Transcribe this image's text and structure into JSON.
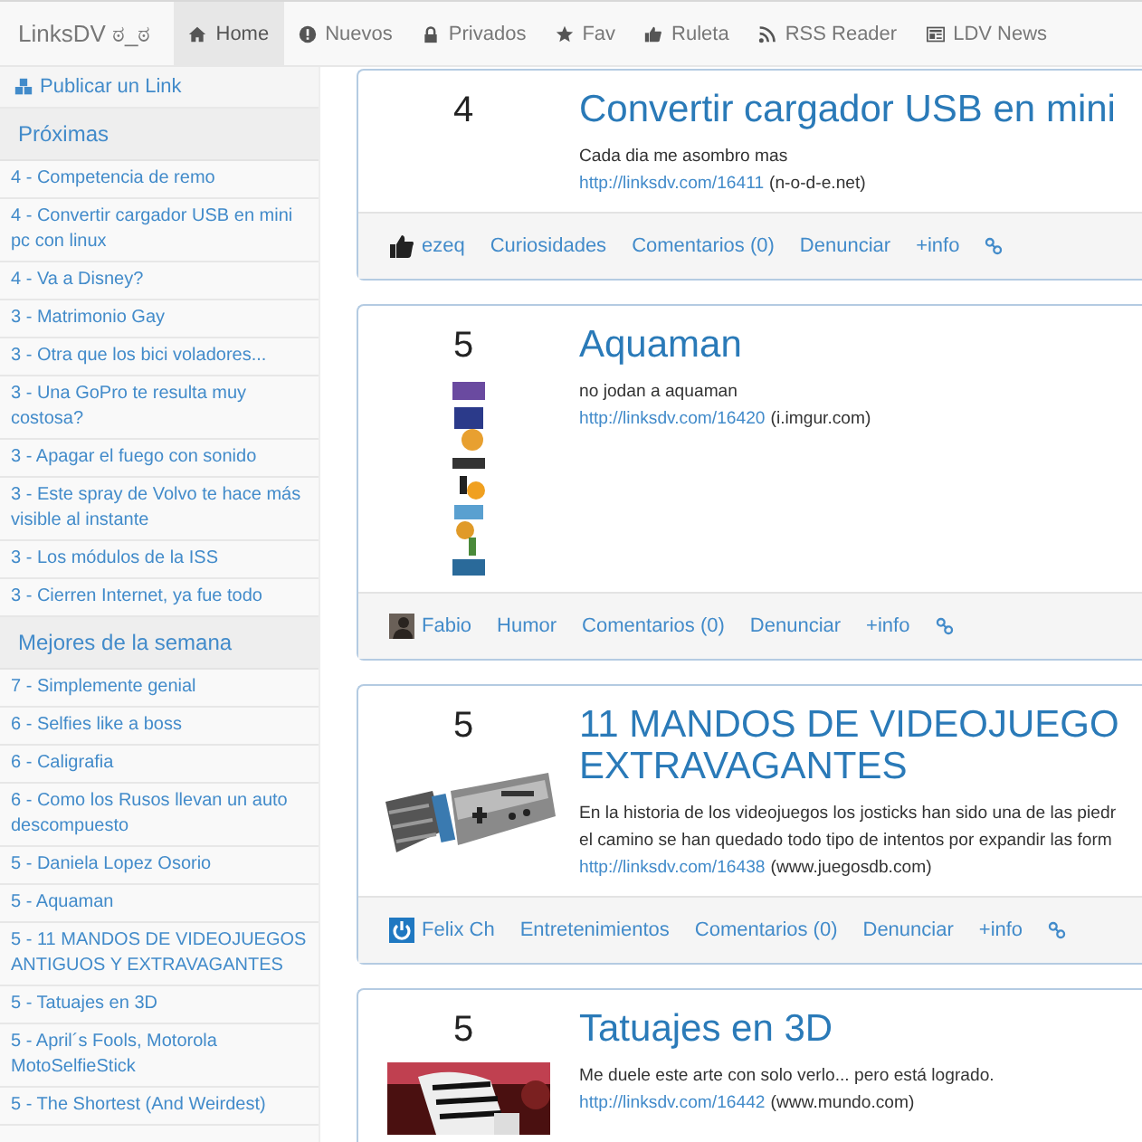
{
  "nav": {
    "brand": "LinksDV ಠ_ಠ",
    "items": [
      {
        "label": "Home",
        "selected": true
      },
      {
        "label": "Nuevos",
        "selected": false
      },
      {
        "label": "Privados",
        "selected": false
      },
      {
        "label": "Fav",
        "selected": false
      },
      {
        "label": "Ruleta",
        "selected": false
      },
      {
        "label": "RSS Reader",
        "selected": false
      },
      {
        "label": "LDV News",
        "selected": false
      }
    ]
  },
  "sidebar": {
    "publish": "Publicar un Link",
    "sections": [
      {
        "heading": "Próximas",
        "items": [
          "4 - Competencia de remo",
          "4 - Convertir cargador USB en mini pc con linux",
          "4 - Va a Disney?",
          "3 - Matrimonio Gay",
          "3 - Otra que los bici voladores...",
          "3 - Una GoPro te resulta muy costosa?",
          "3 - Apagar el fuego con sonido",
          "3 - Este spray de Volvo te hace más visible al instante",
          "3 - Los módulos de la ISS",
          "3 - Cierren Internet, ya fue todo"
        ]
      },
      {
        "heading": "Mejores de la semana",
        "items": [
          "7 - Simplemente genial",
          "6 - Selfies like a boss",
          "6 - Caligrafia",
          "6 - Como los Rusos llevan un auto descompuesto",
          "5 - Daniela Lopez Osorio",
          "5 - Aquaman",
          "5 - 11 MANDOS DE VIDEOJUEGOS ANTIGUOS Y EXTRAVAGANTES",
          "5 - Tatuajes en 3D",
          "5 - April´s Fools, Motorola MotoSelfieStick",
          "5 - The Shortest (And Weirdest)"
        ]
      }
    ]
  },
  "posts": [
    {
      "score": "4",
      "title_lines": [
        "Convertir cargador USB en mini"
      ],
      "description_lines": [
        "Cada dia me asombro mas"
      ],
      "link": "http://linksdv.com/16411",
      "source": "(n-o-d-e.net)",
      "footer": {
        "author": "ezeq",
        "category": "Curiosidades",
        "comments": "Comentarios (0)",
        "report": "Denunciar",
        "info": "+info"
      }
    },
    {
      "score": "5",
      "title_lines": [
        "Aquaman"
      ],
      "description_lines": [
        "no jodan a aquaman"
      ],
      "link": "http://linksdv.com/16420",
      "source": "(i.imgur.com)",
      "thumbnail": {
        "kind": "picture"
      },
      "footer": {
        "author": "Fabio",
        "category": "Humor",
        "comments": "Comentarios (0)",
        "report": "Denunciar",
        "info": "+info"
      }
    },
    {
      "score": "5",
      "title_lines": [
        "11 MANDOS DE VIDEOJUEGO",
        "EXTRAVAGANTES"
      ],
      "description_lines": [
        "En la historia de los videojuegos los josticks han sido una de las piedr",
        "el camino se han quedado todo tipo de intentos por expandir las form"
      ],
      "link": "http://linksdv.com/16438",
      "source": "(www.juegosdb.com)",
      "thumbnail": {
        "kind": "picture"
      },
      "footer": {
        "author": "Felix Ch",
        "category": "Entretenimientos",
        "comments": "Comentarios (0)",
        "report": "Denunciar",
        "info": "+info"
      }
    },
    {
      "score": "5",
      "title_lines": [
        "Tatuajes en 3D"
      ],
      "description_lines": [
        "Me duele este arte con solo verlo... pero está logrado."
      ],
      "link": "http://linksdv.com/16442",
      "source": "(www.mundo.com)",
      "thumbnail": {
        "kind": "picture"
      }
    }
  ]
}
